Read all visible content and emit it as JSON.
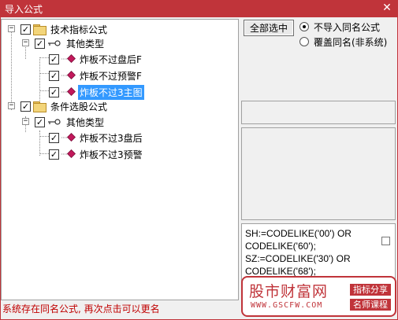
{
  "window": {
    "title": "导入公式",
    "close_glyph": "✕"
  },
  "tree": {
    "nodes": [
      {
        "label": "技术指标公式",
        "checked": "✓",
        "expander": "−",
        "icon": "folder-icon"
      },
      {
        "label": "其他类型",
        "checked": "✓",
        "expander": "−",
        "icon": "key-icon"
      },
      {
        "label": "炸板不过盘后F",
        "checked": "✓",
        "icon": "formula-icon"
      },
      {
        "label": "炸板不过预警F",
        "checked": "✓",
        "icon": "formula-icon"
      },
      {
        "label": "炸板不过3主图",
        "checked": "✓",
        "icon": "formula-icon",
        "selected": true
      },
      {
        "label": "条件选股公式",
        "checked": "✓",
        "expander": "−",
        "icon": "folder-icon"
      },
      {
        "label": "其他类型",
        "checked": "✓",
        "expander": "−",
        "icon": "key-icon"
      },
      {
        "label": "炸板不过3盘后",
        "checked": "✓",
        "icon": "formula-icon"
      },
      {
        "label": "炸板不过3预警",
        "checked": "✓",
        "icon": "formula-icon"
      }
    ]
  },
  "controls": {
    "select_all_label": "全部选中",
    "radio_no_import": "不导入同名公式",
    "radio_overwrite": "覆盖同名(非系统)"
  },
  "code": {
    "lines": [
      "SH:=CODELIKE('00') OR",
      "CODELIKE('60');",
      "SZ:=CODELIKE('30') OR",
      "CODELIKE('68');"
    ]
  },
  "watermark": {
    "title": "股市财富网",
    "url": "WWW.GSCFW.COM",
    "tag1": "指标分享",
    "tag2": "名师课程"
  },
  "status": {
    "message": "系统存在同名公式, 再次点击可以更名"
  },
  "colors": {
    "accent": "#c0343a",
    "selection": "#3399ff",
    "status_text": "#c00000"
  }
}
